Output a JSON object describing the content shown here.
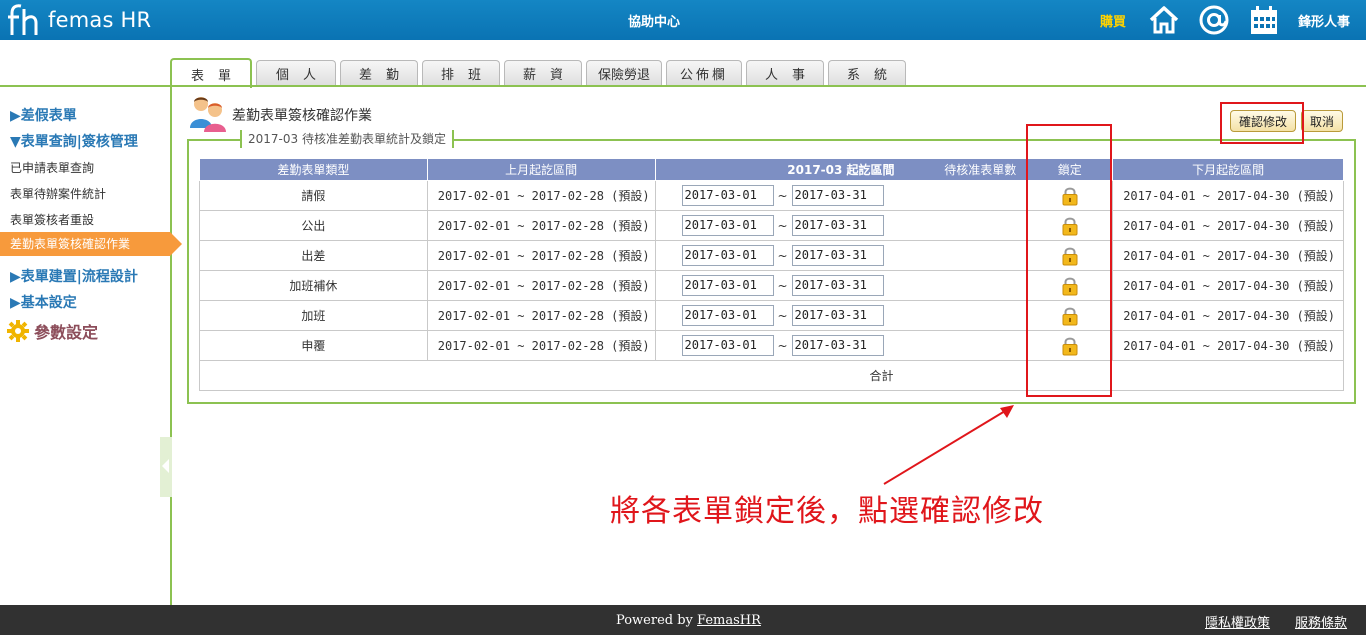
{
  "header": {
    "logo_text": "femas HR",
    "help_center": "協助中心",
    "buy": "購買",
    "company": "鋒形人事",
    "icons": [
      "home-icon",
      "at-icon",
      "calendar-icon"
    ],
    "colors": {
      "bar": "#0a73b3",
      "buy": "#ffd200"
    }
  },
  "tabs": [
    {
      "label": "表單",
      "active": true
    },
    {
      "label": "個人",
      "active": false
    },
    {
      "label": "差勤",
      "active": false
    },
    {
      "label": "排班",
      "active": false
    },
    {
      "label": "薪資",
      "active": false
    },
    {
      "label": "保險勞退",
      "active": false
    },
    {
      "label": "公佈欄",
      "active": false
    },
    {
      "label": "人事",
      "active": false
    },
    {
      "label": "系統",
      "active": false
    }
  ],
  "sidebar": {
    "sections": [
      {
        "label": "▶差假表單"
      },
      {
        "label": "▼表單查詢|簽核管理"
      },
      {
        "label": "▶表單建置|流程設計"
      },
      {
        "label": "▶基本設定"
      }
    ],
    "items": [
      {
        "label": "已申請表單查詢"
      },
      {
        "label": "表單待辦案件統計"
      },
      {
        "label": "表單簽核者重設"
      },
      {
        "label": "差勤表單簽核確認作業",
        "active": true
      }
    ],
    "param": "參數設定"
  },
  "main": {
    "title": "差勤表單簽核確認作業",
    "legend": "2017-03 待核准差勤表單統計及鎖定",
    "confirm_button": "確認修改",
    "cancel_button": "取消",
    "columns": {
      "type": "差勤表單類型",
      "prev": "上月起訖區間",
      "current": "2017-03 起訖區間",
      "pending": "待核准表單數",
      "lock": "鎖定",
      "next": "下月起訖區間"
    },
    "rows": [
      {
        "type": "請假",
        "prev": "2017-02-01 ~ 2017-02-28 (預設)",
        "from": "2017-03-01",
        "to": "2017-03-31",
        "next": "2017-04-01 ~ 2017-04-30 (預設)"
      },
      {
        "type": "公出",
        "prev": "2017-02-01 ~ 2017-02-28 (預設)",
        "from": "2017-03-01",
        "to": "2017-03-31",
        "next": "2017-04-01 ~ 2017-04-30 (預設)"
      },
      {
        "type": "出差",
        "prev": "2017-02-01 ~ 2017-02-28 (預設)",
        "from": "2017-03-01",
        "to": "2017-03-31",
        "next": "2017-04-01 ~ 2017-04-30 (預設)"
      },
      {
        "type": "加班補休",
        "prev": "2017-02-01 ~ 2017-02-28 (預設)",
        "from": "2017-03-01",
        "to": "2017-03-31",
        "next": "2017-04-01 ~ 2017-04-30 (預設)"
      },
      {
        "type": "加班",
        "prev": "2017-02-01 ~ 2017-02-28 (預設)",
        "from": "2017-03-01",
        "to": "2017-03-31",
        "next": "2017-04-01 ~ 2017-04-30 (預設)"
      },
      {
        "type": "申覆",
        "prev": "2017-02-01 ~ 2017-02-28 (預設)",
        "from": "2017-03-01",
        "to": "2017-03-31",
        "next": "2017-04-01 ~ 2017-04-30 (預設)"
      }
    ],
    "total_label": "合計",
    "tilde": "~"
  },
  "annotation": {
    "text": "將各表單鎖定後，點選確認修改",
    "color": "#e0161b"
  },
  "footer": {
    "powered_prefix": "Powered by",
    "powered_link": "FemasHR",
    "privacy": "隱私權政策",
    "terms": "服務條款"
  }
}
